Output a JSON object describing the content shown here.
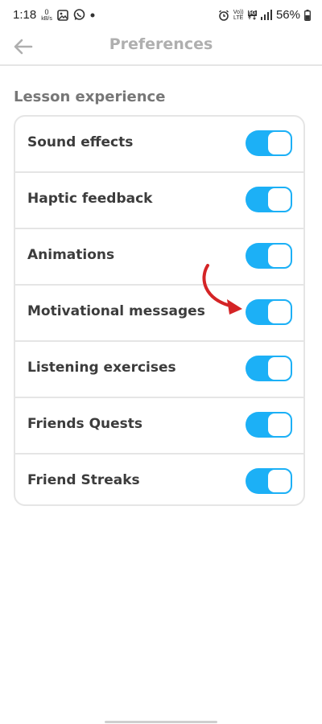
{
  "status_bar": {
    "time": "1:18",
    "data_rate": "0",
    "data_rate_unit": "kB/s",
    "network_top": "Vo))",
    "network_bottom": "LTE",
    "network_5g": "5G",
    "battery": "56%",
    "icons": [
      "data-speed-icon",
      "gallery-icon",
      "whatsapp-icon",
      "notification-dot-icon",
      "alarm-icon",
      "volte-icon",
      "5g-icon",
      "signal-icon",
      "battery-icon"
    ]
  },
  "header": {
    "title": "Preferences",
    "back_icon": "back-arrow-icon"
  },
  "section": {
    "title": "Lesson experience",
    "items": [
      {
        "label": "Sound effects",
        "enabled": true
      },
      {
        "label": "Haptic feedback",
        "enabled": true
      },
      {
        "label": "Animations",
        "enabled": true
      },
      {
        "label": "Motivational messages",
        "enabled": true
      },
      {
        "label": "Listening exercises",
        "enabled": true
      },
      {
        "label": "Friends Quests",
        "enabled": true
      },
      {
        "label": "Friend Streaks",
        "enabled": true
      }
    ]
  },
  "colors": {
    "toggle_on": "#1cb0f6",
    "title_gray": "#afafaf",
    "section_gray": "#777777",
    "divider": "#e5e5e5",
    "annotation_arrow": "#d42426"
  }
}
